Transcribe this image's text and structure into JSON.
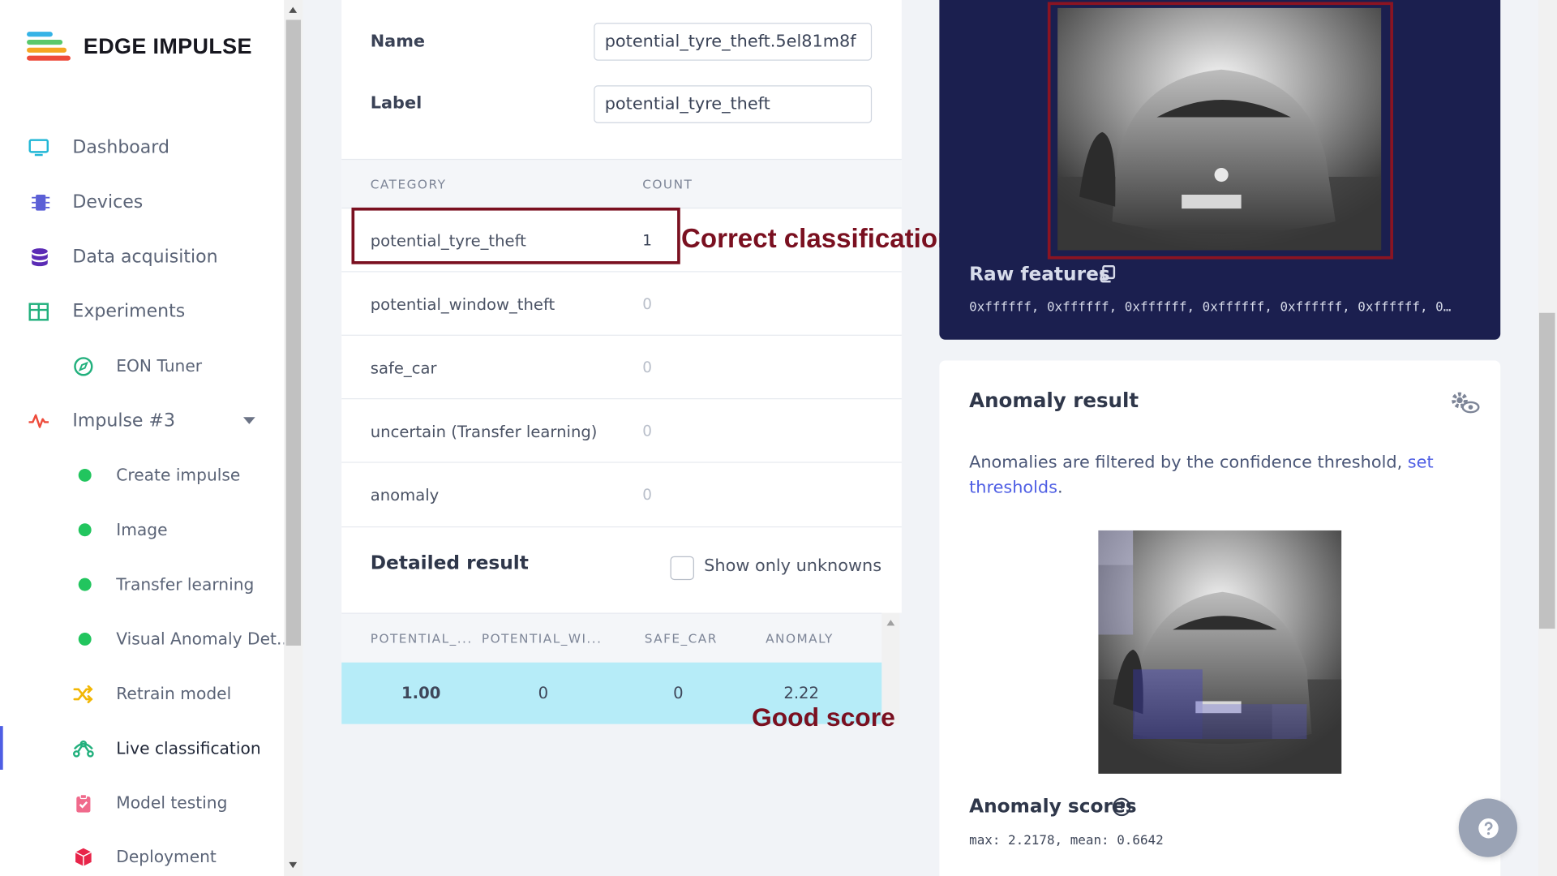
{
  "brand": {
    "name": "EDGE IMPULSE"
  },
  "sidebar": {
    "items": [
      {
        "label": "Dashboard",
        "icon": "monitor-icon"
      },
      {
        "label": "Devices",
        "icon": "chip-icon"
      },
      {
        "label": "Data acquisition",
        "icon": "database-icon"
      },
      {
        "label": "Experiments",
        "icon": "table-icon"
      },
      {
        "label": "EON Tuner",
        "icon": "compass-icon"
      },
      {
        "label": "Impulse #3",
        "icon": "pulse-icon"
      },
      {
        "label": "Create impulse",
        "icon": "green-dot-icon"
      },
      {
        "label": "Image",
        "icon": "green-dot-icon"
      },
      {
        "label": "Transfer learning",
        "icon": "green-dot-icon"
      },
      {
        "label": "Visual Anomaly Det...",
        "icon": "green-dot-icon"
      },
      {
        "label": "Retrain model",
        "icon": "shuffle-icon"
      },
      {
        "label": "Live classification",
        "icon": "nodes-icon"
      },
      {
        "label": "Model testing",
        "icon": "clipboard-check-icon"
      },
      {
        "label": "Deployment",
        "icon": "cube-icon"
      }
    ]
  },
  "sample": {
    "name_label": "Name",
    "name_value": "potential_tyre_theft.5el81m8f",
    "label_label": "Label",
    "label_value": "potential_tyre_theft"
  },
  "categories": {
    "headers": {
      "category": "CATEGORY",
      "count": "COUNT"
    },
    "rows": [
      {
        "name": "potential_tyre_theft",
        "count": "1"
      },
      {
        "name": "potential_window_theft",
        "count": "0"
      },
      {
        "name": "safe_car",
        "count": "0"
      },
      {
        "name": "uncertain (Transfer learning)",
        "count": "0"
      },
      {
        "name": "anomaly",
        "count": "0"
      }
    ]
  },
  "annotations": {
    "correct": "Correct classification",
    "good_score": "Good score"
  },
  "detailed": {
    "title": "Detailed result",
    "checkbox_label": "Show only unknowns",
    "headers": [
      "POTENTIAL_...",
      "POTENTIAL_WI...",
      "SAFE_CAR",
      "ANOMALY"
    ],
    "row": [
      "1.00",
      "0",
      "0",
      "2.22"
    ]
  },
  "raw": {
    "title": "Raw features",
    "values": "0xffffff, 0xffffff, 0xffffff, 0xffffff, 0xffffff, 0xffffff, 0…"
  },
  "anomaly": {
    "title": "Anomaly result",
    "desc_before": "Anomalies are filtered by the confidence threshold, ",
    "link": "set thresholds",
    "desc_after": ".",
    "scores_title": "Anomaly scores",
    "scores": "max: 2.2178, mean: 0.6642"
  },
  "colors": {
    "accent": "#4e5ee4",
    "dark_card": "#1b1f4f",
    "highlight_row": "#b6ecf8",
    "annotation": "#7a1020",
    "dot_green": "#22c55e"
  }
}
